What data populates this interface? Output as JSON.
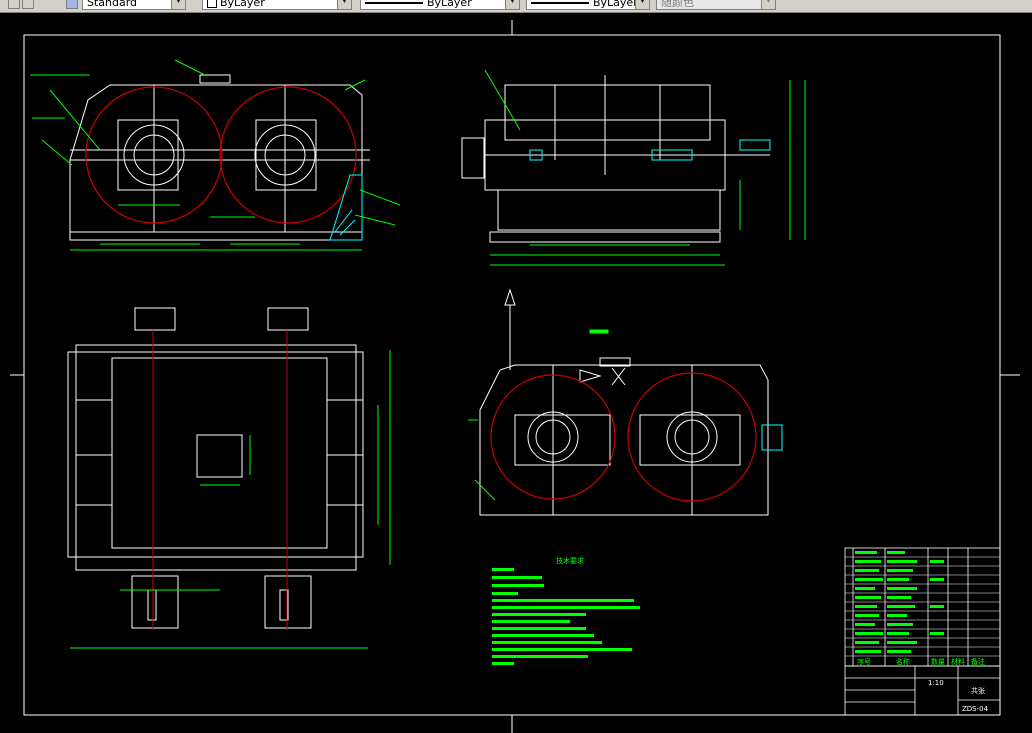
{
  "toolbar": {
    "textstyle_value": "Standard",
    "layer_value": "ByLayer",
    "linetype_value": "ByLayer",
    "lineweight_value": "ByLayer",
    "plotstyle_value": "随颜色"
  },
  "drawing": {
    "tech_requirements_title": "技术要求",
    "title_block": {
      "scale": "1:10",
      "drawing_no": "ZDS-04",
      "total": "共张",
      "header_cols": [
        "序号",
        "名称",
        "数量",
        "材料",
        "备注"
      ]
    }
  },
  "colors": {
    "outline": "#ffffff",
    "gear_circle": "#cc0000",
    "dimension": "#00ff00",
    "hatch": "#00ffff",
    "centerline": "#ff0000",
    "background": "#000000",
    "toolbar": "#d4d0c8"
  }
}
